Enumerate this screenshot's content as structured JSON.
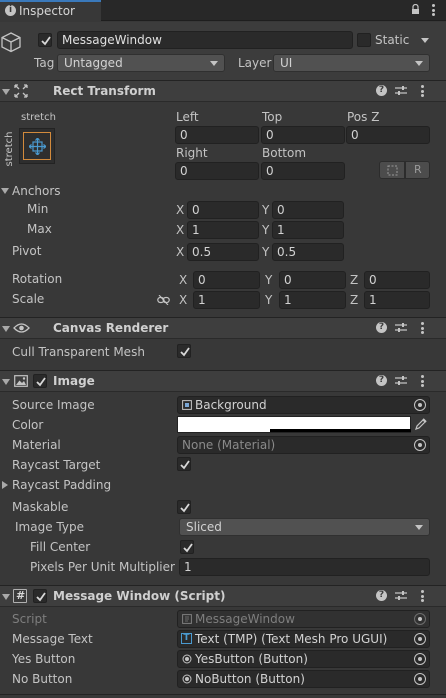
{
  "tab": {
    "title": "Inspector"
  },
  "object": {
    "name": "MessageWindow",
    "static_label": "Static",
    "tag_label": "Tag",
    "tag_value": "Untagged",
    "layer_label": "Layer",
    "layer_value": "UI"
  },
  "rect_transform": {
    "title": "Rect Transform",
    "anchor_preset_top": "stretch",
    "anchor_preset_side": "stretch",
    "left_label": "Left",
    "left_value": "0",
    "top_label": "Top",
    "top_value": "0",
    "posz_label": "Pos Z",
    "posz_value": "0",
    "right_label": "Right",
    "right_value": "0",
    "bottom_label": "Bottom",
    "bottom_value": "0",
    "r_button": "R",
    "anchors_label": "Anchors",
    "min_label": "Min",
    "min_x": "0",
    "min_y": "0",
    "max_label": "Max",
    "max_x": "1",
    "max_y": "1",
    "pivot_label": "Pivot",
    "pivot_x": "0.5",
    "pivot_y": "0.5",
    "rotation_label": "Rotation",
    "rot_x": "0",
    "rot_y": "0",
    "rot_z": "0",
    "scale_label": "Scale",
    "scale_x": "1",
    "scale_y": "1",
    "scale_z": "1",
    "axis_x": "X",
    "axis_y": "Y",
    "axis_z": "Z"
  },
  "canvas_renderer": {
    "title": "Canvas Renderer",
    "cull_label": "Cull Transparent Mesh"
  },
  "image": {
    "title": "Image",
    "source_label": "Source Image",
    "source_value": "Background",
    "color_label": "Color",
    "material_label": "Material",
    "material_value": "None (Material)",
    "raycast_target_label": "Raycast Target",
    "raycast_padding_label": "Raycast Padding",
    "maskable_label": "Maskable",
    "image_type_label": "Image Type",
    "image_type_value": "Sliced",
    "fill_center_label": "Fill Center",
    "ppu_label": "Pixels Per Unit Multiplier",
    "ppu_value": "1"
  },
  "script": {
    "title": "Message Window (Script)",
    "script_label": "Script",
    "script_value": "MessageWindow",
    "message_text_label": "Message Text",
    "message_text_value": "Text (TMP) (Text Mesh Pro UGUI)",
    "yes_label": "Yes Button",
    "yes_value": "YesButton (Button)",
    "no_label": "No Button",
    "no_value": "NoButton (Button)"
  },
  "colors": {
    "panel": "#383838",
    "header": "#3e3e3e",
    "field": "#2a2a2a",
    "accent": "#4a9ad0"
  }
}
